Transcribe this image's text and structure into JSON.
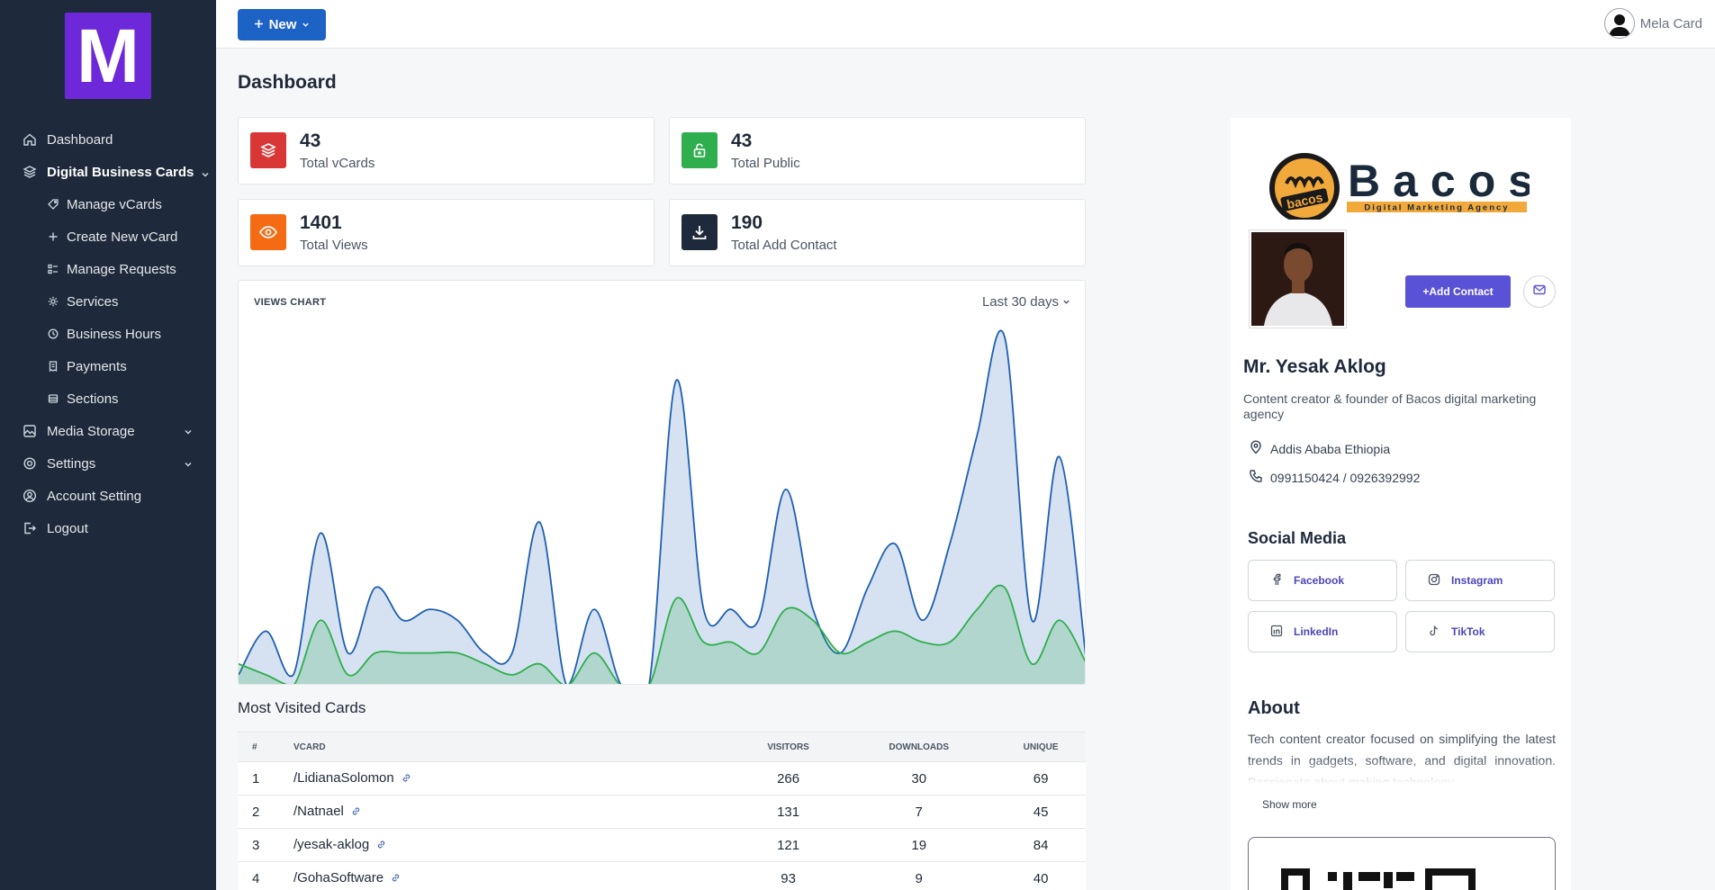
{
  "sidebar": {
    "logo_letter": "M",
    "items": [
      {
        "label": "Dashboard",
        "icon": "home-icon"
      },
      {
        "label": "Digital Business Cards",
        "icon": "layers-icon"
      },
      {
        "label": "Manage vCards",
        "icon": "tag-icon"
      },
      {
        "label": "Create New vCard",
        "icon": "plus-icon"
      },
      {
        "label": "Manage Requests",
        "icon": "list-icon"
      },
      {
        "label": "Services",
        "icon": "gear-icon"
      },
      {
        "label": "Business Hours",
        "icon": "clock-icon"
      },
      {
        "label": "Payments",
        "icon": "receipt-icon"
      },
      {
        "label": "Sections",
        "icon": "sections-icon"
      },
      {
        "label": "Media Storage",
        "icon": "image-icon"
      },
      {
        "label": "Settings",
        "icon": "gear-icon"
      },
      {
        "label": "Account Setting",
        "icon": "user-circle-icon"
      },
      {
        "label": "Logout",
        "icon": "logout-icon"
      }
    ]
  },
  "topbar": {
    "new_label": "New",
    "user_name": "Mela Card"
  },
  "page_title": "Dashboard",
  "stats": [
    {
      "value": "43",
      "label": "Total vCards",
      "color": "#d93636"
    },
    {
      "value": "43",
      "label": "Total Public",
      "color": "#2fae4e"
    },
    {
      "value": "1401",
      "label": "Total Views",
      "color": "#f46b13"
    },
    {
      "value": "190",
      "label": "Total Add Contact",
      "color": "#1e2a3b"
    }
  ],
  "chart": {
    "title": "VIEWS CHART",
    "range": "Last 30 days"
  },
  "chart_data": {
    "type": "area",
    "x": [
      1,
      2,
      3,
      4,
      5,
      6,
      7,
      8,
      9,
      10,
      11,
      12,
      13,
      14,
      15,
      16,
      17,
      18,
      19,
      20,
      21,
      22,
      23,
      24,
      25,
      26,
      27,
      28,
      29,
      30
    ],
    "series": [
      {
        "values": [
          1,
          5,
          1,
          14,
          3,
          9,
          6,
          7,
          6,
          3,
          3,
          15,
          0,
          7,
          0,
          0,
          28,
          7,
          7,
          6,
          18,
          7,
          3,
          9,
          13,
          6,
          13,
          23,
          32,
          6,
          21,
          2
        ]
      },
      {
        "values": [
          2,
          1,
          0,
          6,
          1,
          3,
          3,
          3,
          3,
          2,
          1,
          2,
          0,
          3,
          0,
          0,
          8,
          4,
          4,
          3,
          7,
          6,
          3,
          4,
          5,
          4,
          4,
          7,
          9,
          2,
          6,
          2
        ]
      }
    ],
    "colors": {
      "views": "#1d5fb0",
      "unique": "#2fae4e"
    }
  },
  "table": {
    "title": "Most Visited Cards",
    "headers": [
      "#",
      "VCARD",
      "VISITORS",
      "DOWNLOADS",
      "UNIQUE"
    ],
    "rows": [
      [
        "1",
        "/LidianaSolomon",
        "266",
        "30",
        "69"
      ],
      [
        "2",
        "/Natnael",
        "131",
        "7",
        "45"
      ],
      [
        "3",
        "/yesak-aklog",
        "121",
        "19",
        "84"
      ],
      [
        "4",
        "/GohaSoftware",
        "93",
        "9",
        "40"
      ]
    ]
  },
  "profile": {
    "brand_name": "Bacos",
    "brand_tagline": "Digital Marketing Agency",
    "brand_badge": "bacos",
    "add_contact": "+Add Contact",
    "name": "Mr. Yesak Aklog",
    "description": "Content creator & founder of Bacos digital marketing agency",
    "location": "Addis Ababa Ethiopia",
    "phone": "0991150424 / 0926392992",
    "social_title": "Social Media",
    "socials": [
      {
        "label": "Facebook",
        "icon": "facebook-icon"
      },
      {
        "label": "Instagram",
        "icon": "instagram-icon"
      },
      {
        "label": "LinkedIn",
        "icon": "linkedin-icon"
      },
      {
        "label": "TikTok",
        "icon": "tiktok-icon"
      }
    ],
    "about_title": "About",
    "about_text": "Tech content creator focused on simplifying the latest trends in gadgets, software, and digital innovation. Passionate about making technology",
    "show_more": "Show more"
  }
}
